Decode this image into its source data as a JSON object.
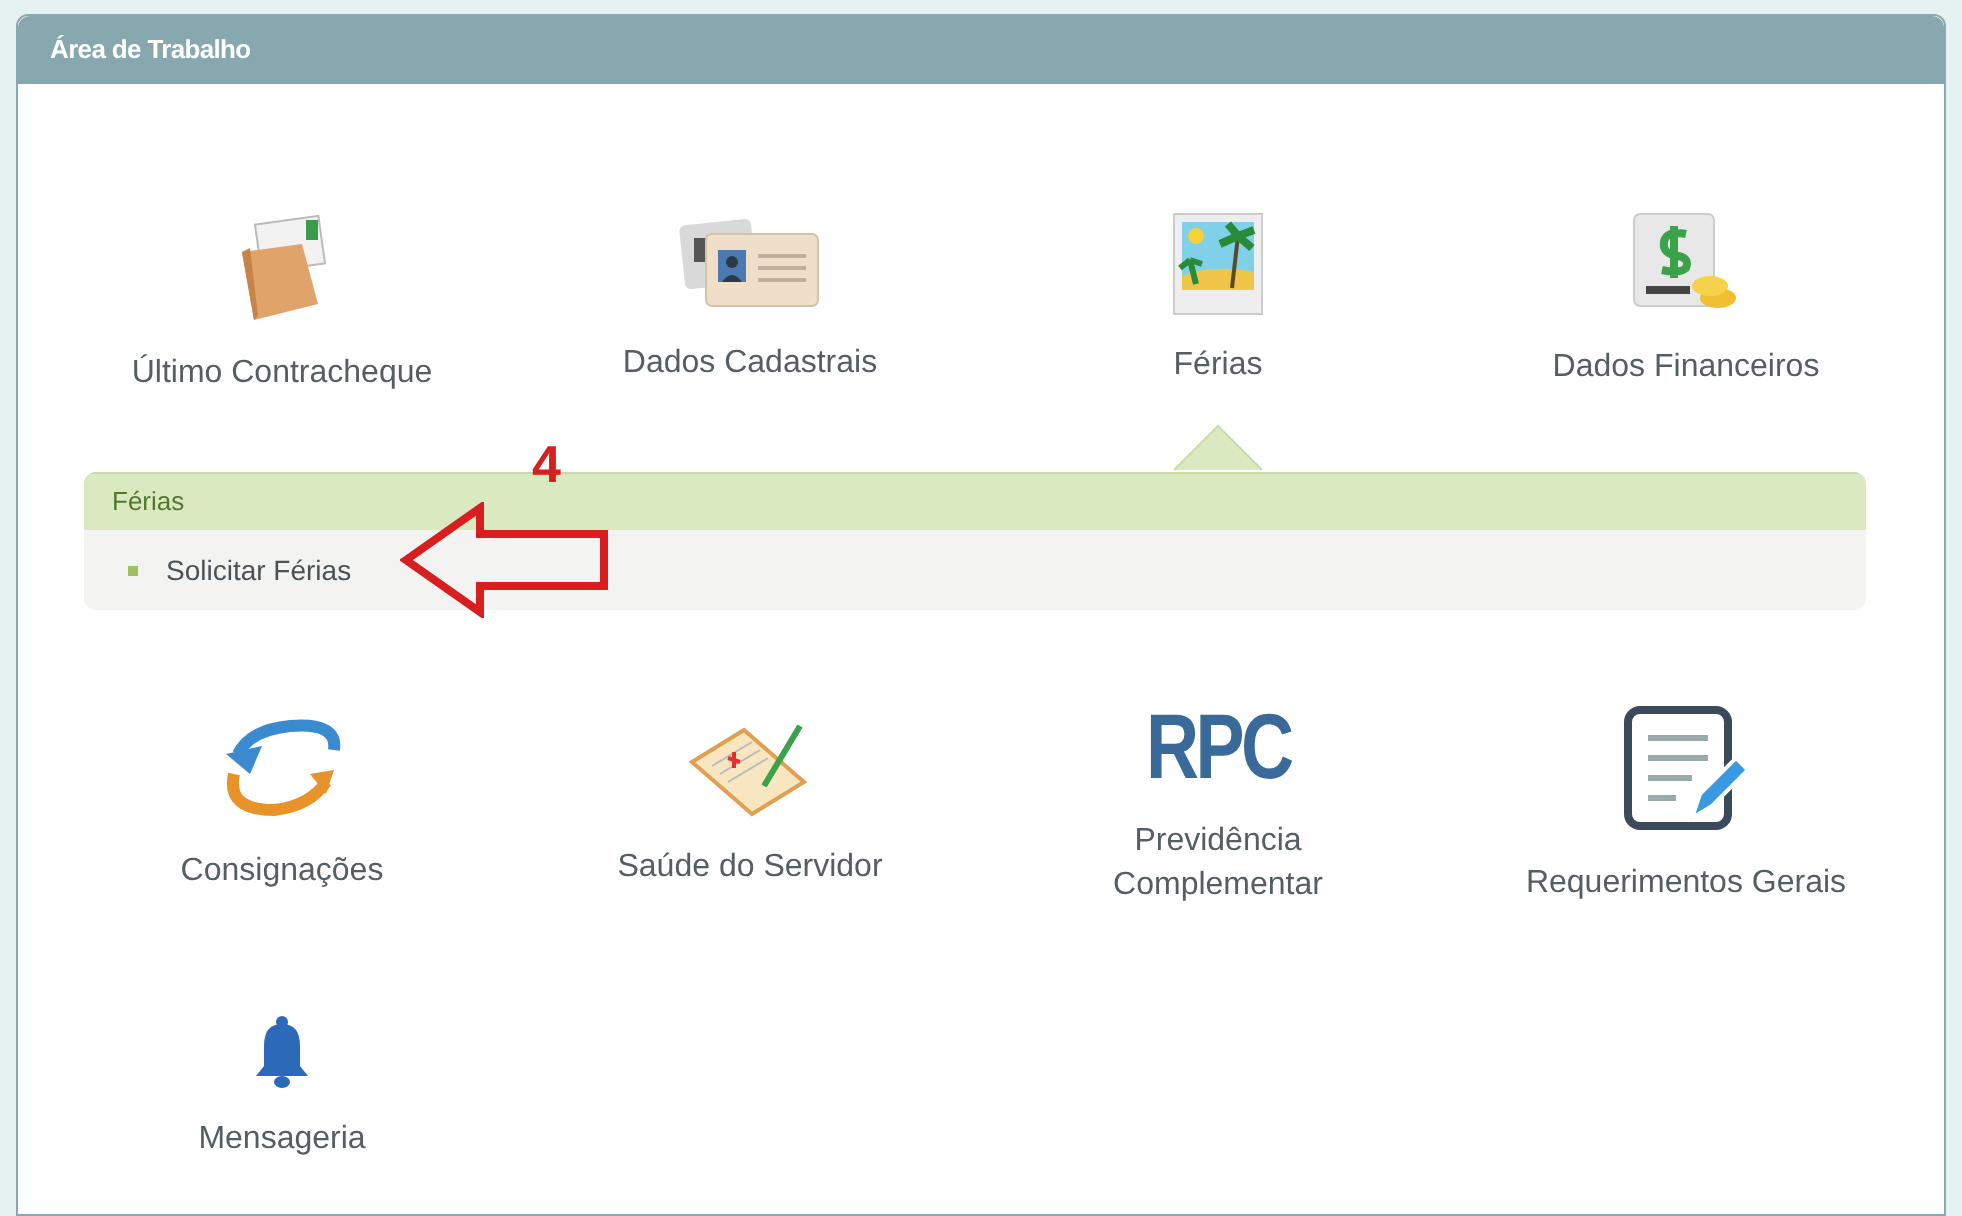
{
  "panel": {
    "title": "Área de Trabalho"
  },
  "rows": [
    [
      {
        "label": "Último Contracheque",
        "expanded": false
      },
      {
        "label": "Dados Cadastrais",
        "expanded": false
      },
      {
        "label": "Férias",
        "expanded": true
      },
      {
        "label": "Dados Financeiros",
        "expanded": false
      }
    ],
    [
      {
        "label": "Consignações",
        "expanded": false
      },
      {
        "label": "Saúde do Servidor",
        "expanded": false
      },
      {
        "label": "Previdência Complementar",
        "logo_text": "RPC",
        "expanded": false
      },
      {
        "label": "Requerimentos Gerais",
        "expanded": false
      }
    ],
    [
      {
        "label": "Mensageria",
        "expanded": false
      }
    ]
  ],
  "submenu": {
    "title": "Férias",
    "items": [
      {
        "label": "Solicitar Férias"
      }
    ]
  },
  "annotation": {
    "text": "4"
  }
}
